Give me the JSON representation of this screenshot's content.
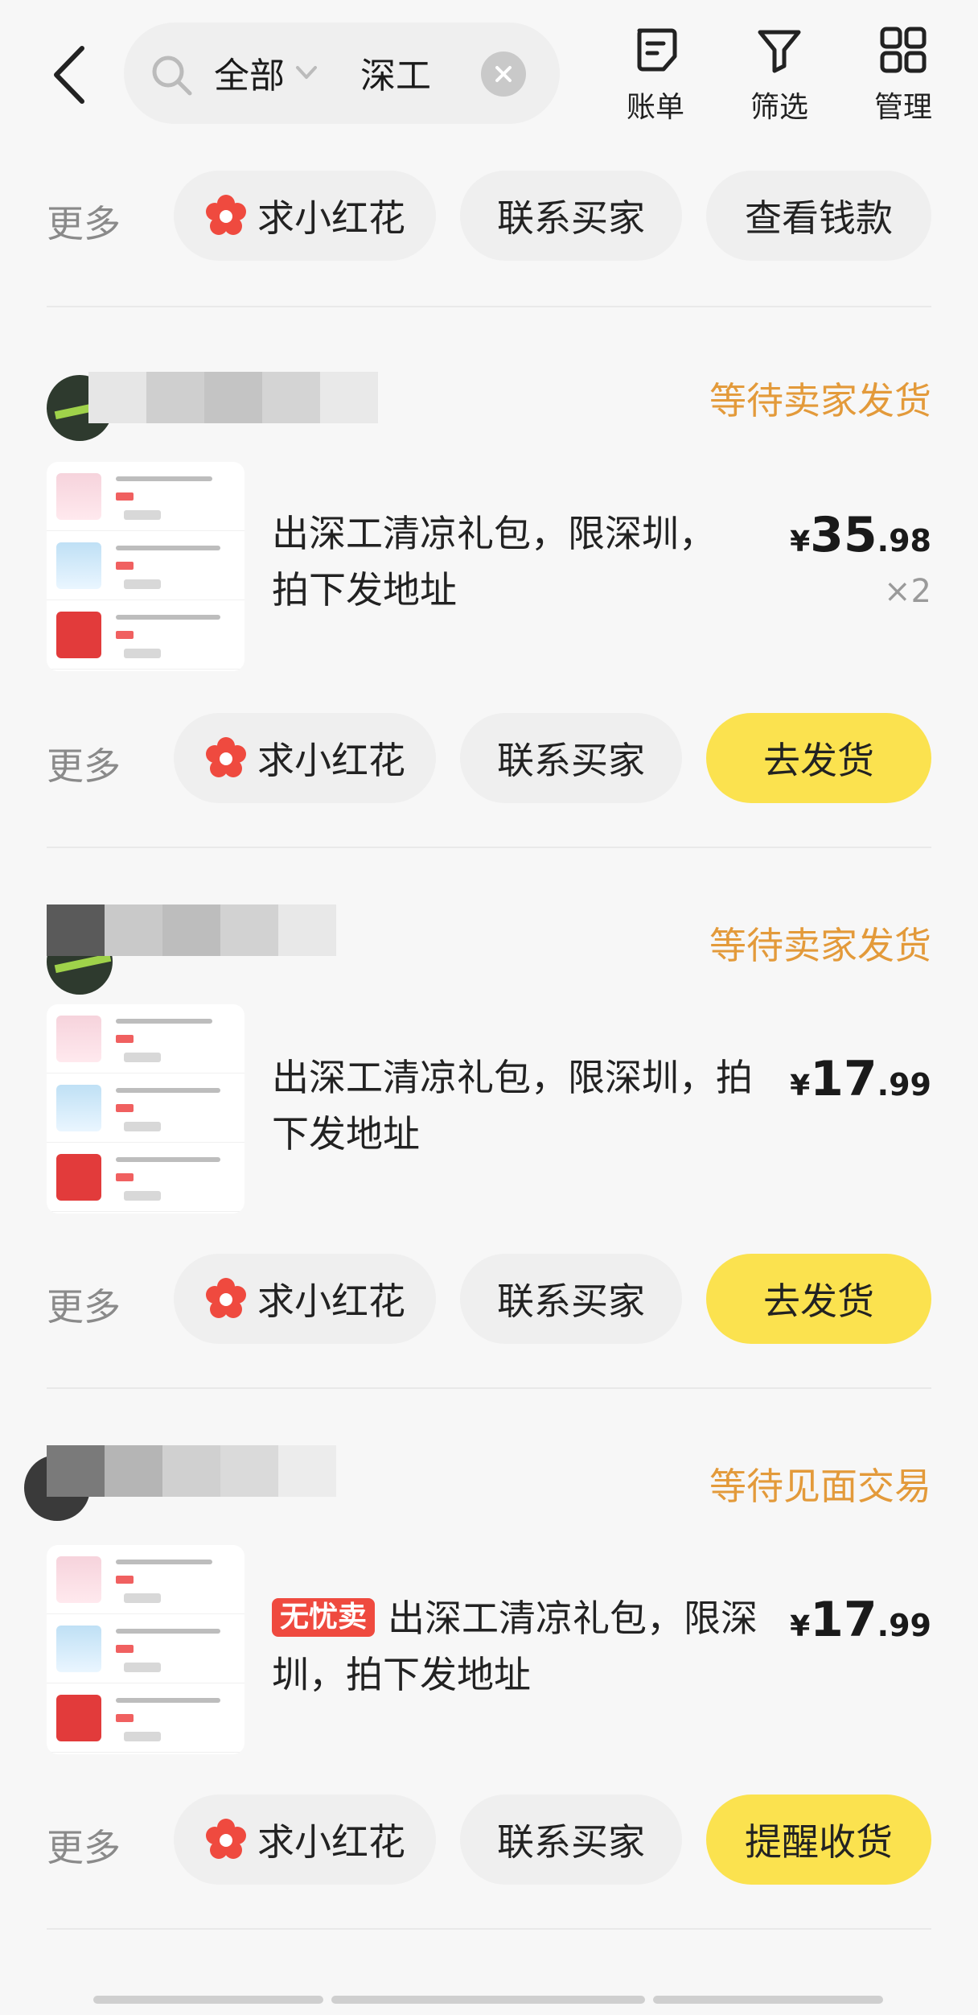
{
  "header": {
    "search_scope": "全部",
    "search_query": "深工",
    "actions": [
      {
        "label": "账单",
        "icon": "bill-icon"
      },
      {
        "label": "筛选",
        "icon": "filter-icon"
      },
      {
        "label": "管理",
        "icon": "grid-icon"
      }
    ]
  },
  "top_actions": {
    "more": "更多",
    "ask_flower": "求小红花",
    "contact_buyer": "联系买家",
    "view_funds": "查看钱款"
  },
  "orders": [
    {
      "status": "等待卖家发货",
      "title_line1": "出深工清凉礼包，限深圳，",
      "title_line2": "拍下发地址",
      "badge": "",
      "price_currency": "¥",
      "price_int": "35",
      "price_dec": ".98",
      "quantity": "×2",
      "more": "更多",
      "ask_flower": "求小红花",
      "contact_buyer": "联系买家",
      "primary_action": "去发货"
    },
    {
      "status": "等待卖家发货",
      "title_line1": "出深工清凉礼包，限深圳，拍",
      "title_line2": "下发地址",
      "badge": "",
      "price_currency": "¥",
      "price_int": "17",
      "price_dec": ".99",
      "quantity": "",
      "more": "更多",
      "ask_flower": "求小红花",
      "contact_buyer": "联系买家",
      "primary_action": "去发货"
    },
    {
      "status": "等待见面交易",
      "title_line1": "出深工清凉礼包，限深",
      "title_line2": "圳，拍下发地址",
      "badge": "无忧卖",
      "price_currency": "¥",
      "price_int": "17",
      "price_dec": ".99",
      "quantity": "",
      "more": "更多",
      "ask_flower": "求小红花",
      "contact_buyer": "联系买家",
      "primary_action": "提醒收货"
    }
  ],
  "colors": {
    "accent_yellow": "#fbe24f",
    "status_orange": "#e39a3a",
    "badge_red": "#ef4a3f"
  }
}
